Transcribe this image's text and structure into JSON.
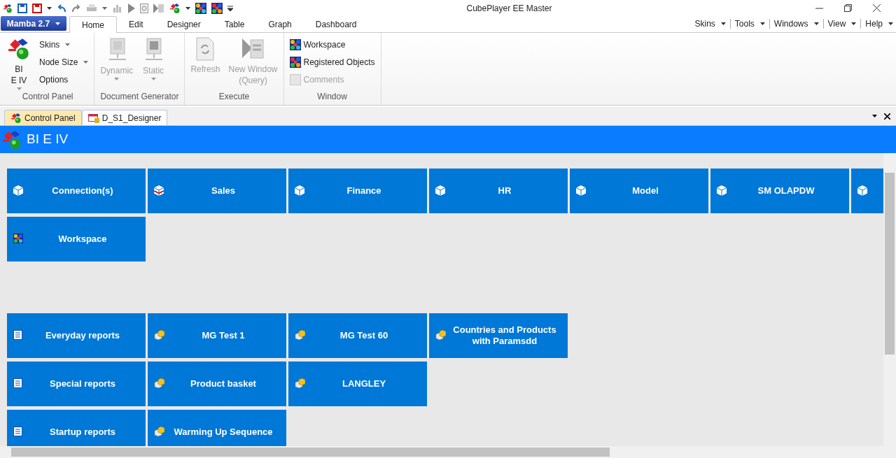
{
  "title_bar": {
    "title": "CubePlayer EE Master"
  },
  "app_menu": {
    "label": "Mamba 2.7"
  },
  "ribbon_tabs": [
    {
      "label": "Home",
      "selected": true
    },
    {
      "label": "Edit",
      "selected": false
    },
    {
      "label": "Designer",
      "selected": false
    },
    {
      "label": "Table",
      "selected": false
    },
    {
      "label": "Graph",
      "selected": false
    },
    {
      "label": "Dashboard",
      "selected": false
    }
  ],
  "right_menus": [
    "Skins",
    "Tools",
    "Windows",
    "View",
    "Help"
  ],
  "ribbon_groups": [
    {
      "label": "Control Panel",
      "items": [
        {
          "kind": "large",
          "label": "BI\nE IV",
          "dropdown": true,
          "disabled": false
        },
        {
          "kind": "small",
          "label": "Skins",
          "dropdown": true,
          "disabled": false
        },
        {
          "kind": "small",
          "label": "Node Size",
          "dropdown": true,
          "disabled": false
        },
        {
          "kind": "small",
          "label": "Options",
          "dropdown": false,
          "disabled": false
        }
      ]
    },
    {
      "label": "Document Generator",
      "items": [
        {
          "kind": "large",
          "label": "Dynamic",
          "dropdown": true,
          "disabled": true
        },
        {
          "kind": "large",
          "label": "Static",
          "dropdown": true,
          "disabled": true
        }
      ]
    },
    {
      "label": "Execute",
      "items": [
        {
          "kind": "large",
          "label": "Refresh",
          "dropdown": false,
          "disabled": true
        },
        {
          "kind": "large",
          "label": "New Window\n(Query)",
          "dropdown": false,
          "disabled": true
        }
      ]
    },
    {
      "label": "Window",
      "items": [
        {
          "kind": "small",
          "label": "Workspace",
          "dropdown": false,
          "disabled": false
        },
        {
          "kind": "small",
          "label": "Registered Objects",
          "dropdown": false,
          "disabled": false
        },
        {
          "kind": "small",
          "label": "Comments",
          "dropdown": false,
          "disabled": true
        }
      ]
    }
  ],
  "document_tabs": [
    {
      "label": "Control Panel",
      "selected": true
    },
    {
      "label": "D_S1_Designer",
      "selected": false
    }
  ],
  "panel_header": {
    "title": "BI E IV"
  },
  "tile_sections": [
    {
      "rows": [
        [
          {
            "kind": "cube",
            "label": "Connection(s)"
          },
          {
            "kind": "striped",
            "label": "Sales"
          },
          {
            "kind": "cube",
            "label": "Finance"
          },
          {
            "kind": "cube",
            "label": "HR"
          },
          {
            "kind": "cube",
            "label": "Model"
          },
          {
            "kind": "cube",
            "label": "SM OLAPDW"
          },
          {
            "kind": "cube"
          }
        ],
        [
          {
            "kind": "workspace",
            "label": "Workspace"
          }
        ]
      ]
    },
    {
      "rows": [
        [
          {
            "kind": "report",
            "label": "Everyday reports"
          },
          {
            "kind": "package",
            "label": "MG Test 1"
          },
          {
            "kind": "package",
            "label": "MG Test 60"
          },
          {
            "kind": "package",
            "label": "Countries and Products with Paramsdd"
          }
        ],
        [
          {
            "kind": "report",
            "label": "Special reports"
          },
          {
            "kind": "package",
            "label": "Product basket"
          },
          {
            "kind": "package",
            "label": "LANGLEY"
          }
        ],
        [
          {
            "kind": "report",
            "label": "Startup reports"
          },
          {
            "kind": "package",
            "label": "Warming Up Sequence"
          }
        ]
      ]
    }
  ]
}
